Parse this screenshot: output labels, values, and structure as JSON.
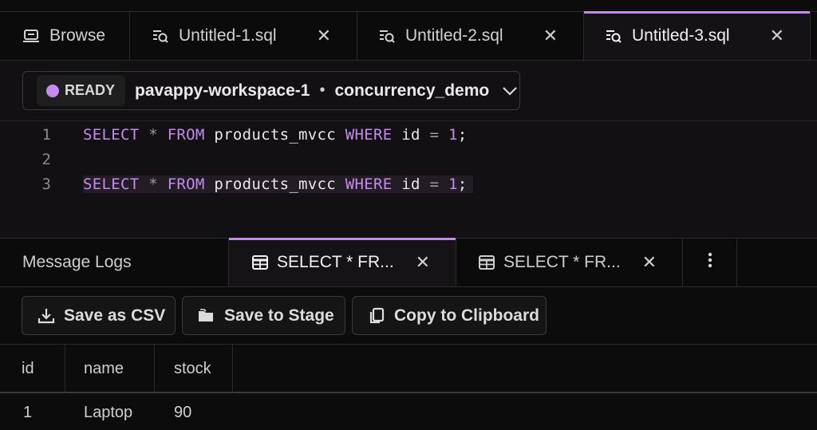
{
  "top_tabs": [
    {
      "label": "Browse",
      "icon": "browse-icon"
    },
    {
      "label": "Untitled-1.sql",
      "icon": "sql-file-icon"
    },
    {
      "label": "Untitled-2.sql",
      "icon": "sql-file-icon"
    },
    {
      "label": "Untitled-3.sql",
      "icon": "sql-file-icon",
      "active": true
    }
  ],
  "context": {
    "status": "READY",
    "workspace": "pavappy-workspace-1",
    "separator": "•",
    "database": "concurrency_demo"
  },
  "editor": {
    "lines": [
      {
        "number": "1",
        "kw1": "SELECT",
        "star": "*",
        "kw2": "FROM",
        "table": "products_mvcc",
        "kw3": "WHERE",
        "col": "id",
        "eq": "=",
        "val": "1",
        "semi": ";"
      },
      {
        "number": "2"
      },
      {
        "number": "3",
        "kw1": "SELECT",
        "star": "*",
        "kw2": "FROM",
        "table": "products_mvcc",
        "kw3": "WHERE",
        "col": "id",
        "eq": "=",
        "val": "1",
        "semi": ";"
      }
    ]
  },
  "result_tabs": [
    {
      "label": "Message Logs"
    },
    {
      "label": "SELECT * FR...",
      "icon": "table-icon",
      "active": true
    },
    {
      "label": "SELECT * FR...",
      "icon": "table-icon"
    }
  ],
  "toolbar": {
    "save_csv": "Save as CSV",
    "save_stage": "Save to Stage",
    "copy_clipboard": "Copy to Clipboard"
  },
  "table": {
    "columns": [
      "id",
      "name",
      "stock"
    ],
    "rows": [
      [
        "1",
        "Laptop",
        "90"
      ]
    ]
  },
  "colors": {
    "accent": "#c58af0",
    "background": "#0d0c0d"
  }
}
